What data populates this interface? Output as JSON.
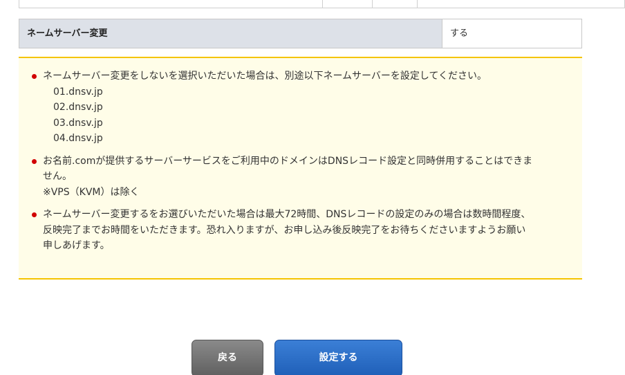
{
  "setting": {
    "label": "ネームサーバー変更",
    "value": "する"
  },
  "notice": {
    "item1_line1": "ネームサーバー変更をしないを選択いただいた場合は、別途以下ネームサーバーを設定してください。",
    "nameservers": [
      "01.dnsv.jp",
      "02.dnsv.jp",
      "03.dnsv.jp",
      "04.dnsv.jp"
    ],
    "item2_line1": "お名前.comが提供するサーバーサービスをご利用中のドメインはDNSレコード設定と同時併用することはできま",
    "item2_line2": "せん。",
    "item2_line3": "※VPS（KVM）は除く",
    "item3_line1": "ネームサーバー変更するをお選びいただいた場合は最大72時間、DNSレコードの設定のみの場合は数時間程度、",
    "item3_line2": "反映完了までお時間をいただきます。恐れ入りますが、お申し込み後反映完了をお待ちくださいますようお願い",
    "item3_line3": "申しあげます。",
    "bullet_color": "#d10000"
  },
  "buttons": {
    "back_label": "戻る",
    "submit_label": "設定する"
  }
}
